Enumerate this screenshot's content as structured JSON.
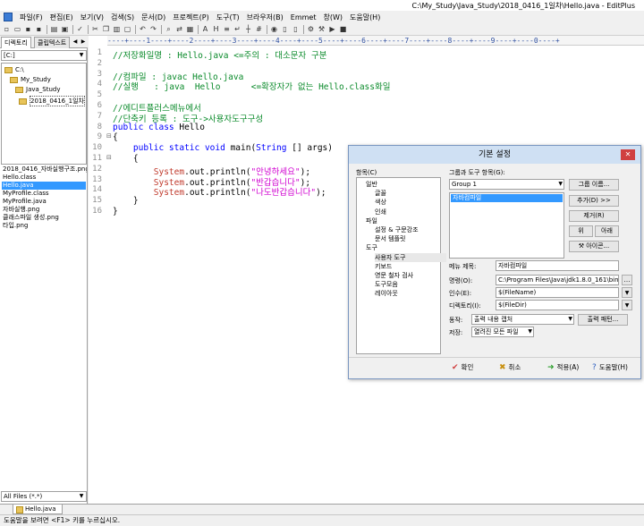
{
  "window": {
    "title": "C:\\My_Study\\Java_Study\\2018_0416_1일차\\Hello.java - EditPlus"
  },
  "menu": [
    "파일(F)",
    "편집(E)",
    "보기(V)",
    "검색(S)",
    "문서(D)",
    "프로젝트(P)",
    "도구(T)",
    "브라우저(B)",
    "Emmet",
    "창(W)",
    "도움말(H)"
  ],
  "left_panel": {
    "tabs": [
      "디렉토리",
      "클립텍스트"
    ],
    "drive": "[C:]",
    "folders": [
      "C:\\",
      "My_Study",
      "Java_Study",
      "2018_0416_1일차"
    ],
    "files": [
      "2018_0416_자바실행구조.png",
      "Hello.class",
      "Hello.java",
      "MyProfile.class",
      "MyProfile.java",
      "자바실행.png",
      "클래스파일 생성.png",
      "타입.png"
    ],
    "selected_file": "Hello.java",
    "filter": "All Files (*.*)"
  },
  "editor": {
    "ruler": "----+----1----+----2----+----3----+----4----+----5----+----6----+----7----+----8----+----9----+----0----+",
    "lines": [
      {
        "n": "1",
        "parts": [
          {
            "c": "cm",
            "t": "//저장화일명 : Hello.java <=주의 : 대소문자 구분"
          }
        ]
      },
      {
        "n": "2",
        "parts": []
      },
      {
        "n": "3",
        "parts": [
          {
            "c": "cm",
            "t": "//컴파일 : javac Hello.java"
          }
        ]
      },
      {
        "n": "4",
        "parts": [
          {
            "c": "cm",
            "t": "//실행   : java  Hello      <=확장자가 없는 Hello.class화일"
          }
        ]
      },
      {
        "n": "5",
        "parts": []
      },
      {
        "n": "6",
        "parts": [
          {
            "c": "cm",
            "t": "//에디트플러스메뉴에서"
          }
        ]
      },
      {
        "n": "7",
        "parts": [
          {
            "c": "cm",
            "t": "//단축키 등록 : 도구->사용자도구구성"
          }
        ]
      },
      {
        "n": "8",
        "parts": [
          {
            "c": "kw",
            "t": "public class"
          },
          {
            "c": "tx",
            "t": " Hello"
          }
        ]
      },
      {
        "n": "9",
        "parts": [
          {
            "c": "tx",
            "t": "{"
          }
        ]
      },
      {
        "n": "10",
        "parts": [
          {
            "c": "tx",
            "t": "    "
          },
          {
            "c": "kw",
            "t": "public static void"
          },
          {
            "c": "tx",
            "t": " main("
          },
          {
            "c": "ty",
            "t": "String"
          },
          {
            "c": "tx",
            "t": " [] args)"
          }
        ]
      },
      {
        "n": "11",
        "parts": [
          {
            "c": "tx",
            "t": "    {"
          }
        ]
      },
      {
        "n": "12",
        "parts": [
          {
            "c": "tx",
            "t": "        "
          },
          {
            "c": "sy",
            "t": "System"
          },
          {
            "c": "tx",
            "t": ".out.println("
          },
          {
            "c": "st",
            "t": "\"안녕하세요\""
          },
          {
            "c": "tx",
            "t": ");"
          }
        ]
      },
      {
        "n": "13",
        "parts": [
          {
            "c": "tx",
            "t": "        "
          },
          {
            "c": "sy",
            "t": "System"
          },
          {
            "c": "tx",
            "t": ".out.println("
          },
          {
            "c": "st",
            "t": "\"반갑습니다\""
          },
          {
            "c": "tx",
            "t": ");"
          }
        ]
      },
      {
        "n": "14",
        "parts": [
          {
            "c": "tx",
            "t": "        "
          },
          {
            "c": "sy",
            "t": "System"
          },
          {
            "c": "tx",
            "t": ".out.println("
          },
          {
            "c": "st",
            "t": "\"나도반갑습니다\""
          },
          {
            "c": "tx",
            "t": ");"
          }
        ]
      },
      {
        "n": "15",
        "parts": [
          {
            "c": "tx",
            "t": "    }"
          }
        ]
      },
      {
        "n": "16",
        "parts": [
          {
            "c": "tx",
            "t": "}"
          }
        ]
      }
    ]
  },
  "doc_tab": "Hello.java",
  "status": "도움말을 보려면 <F1> 키를 누르십시오.",
  "dialog": {
    "title": "기본 설정",
    "categories_label": "항목(C)",
    "categories": [
      {
        "t": "일반",
        "lvl": 0
      },
      {
        "t": "글꼴",
        "lvl": 1
      },
      {
        "t": "색상",
        "lvl": 1
      },
      {
        "t": "인쇄",
        "lvl": 1
      },
      {
        "t": "파일",
        "lvl": 0
      },
      {
        "t": "설정 & 구문강조",
        "lvl": 1
      },
      {
        "t": "문서 템플릿",
        "lvl": 1
      },
      {
        "t": "도구",
        "lvl": 0
      },
      {
        "t": "사용자 도구",
        "lvl": 1
      },
      {
        "t": "키보드",
        "lvl": 1
      },
      {
        "t": "영문 철자 검사",
        "lvl": 1
      },
      {
        "t": "도구모음",
        "lvl": 1
      },
      {
        "t": "레이아웃",
        "lvl": 1
      }
    ],
    "selected_category": "사용자 도구",
    "groups_label": "그룹과 도구 항목(G):",
    "group_value": "Group 1",
    "tool_item": "자바컴파일",
    "buttons": {
      "group_name": "그룹 이름...",
      "add_tool": "추가(D) >>",
      "remove": "제거(R)",
      "up": "위",
      "down": "아래",
      "icon": "아이콘...",
      "output_pattern": "출력 패턴...",
      "ok": "확인",
      "cancel": "취소",
      "apply": "적용(A)",
      "help": "도움말(H)"
    },
    "fields": {
      "menu_title_label": "메뉴 제목:",
      "menu_title": "자바컴파일",
      "command_label": "명령(O):",
      "command": "C:\\Program Files\\Java\\jdk1.8.0_161\\bin",
      "args_label": "인수(E):",
      "args": "$(FileName)",
      "dir_label": "디렉토리(I):",
      "dir": "$(FileDir)",
      "action_label": "동작:",
      "action": "출력 내용 캡처",
      "save_label": "저장:",
      "save": "열려진 모든 파일"
    }
  }
}
